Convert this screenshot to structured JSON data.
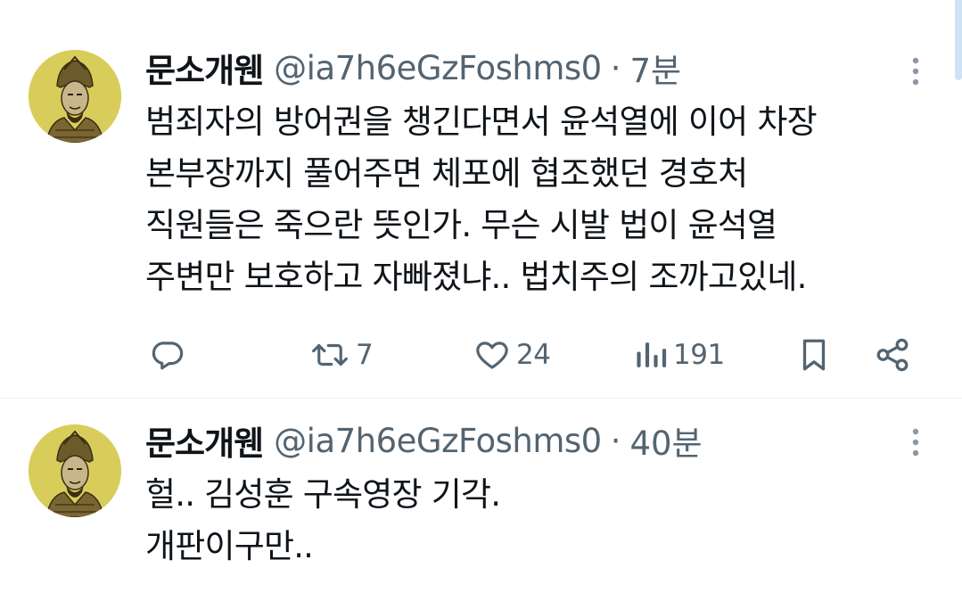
{
  "colors": {
    "text_primary": "#0f1419",
    "text_secondary": "#536471",
    "avatar_bg": "#d8cd5a",
    "divider": "#eff3f4",
    "scrollbar": "#cfe3f7"
  },
  "tweets": [
    {
      "author_name": "문소개웬",
      "handle": "@ia7h6eGzFoshms0",
      "separator": "·",
      "time": "7분",
      "avatar_icon": "warrior-portrait-avatar",
      "more_icon": "more-vertical-icon",
      "lines": [
        "범죄자의 방어권을 챙긴다면서 윤석열에 이어 차장",
        "본부장까지 풀어주면 체포에 협조했던 경호처",
        "직원들은 죽으란 뜻인가. 무슨 시발 법이 윤석열",
        "주변만 보호하고 자빠졌냐.. 법치주의 조까고있네."
      ],
      "actions": {
        "reply_icon": "reply-icon",
        "retweet_icon": "retweet-icon",
        "retweet_count": "7",
        "like_icon": "heart-icon",
        "like_count": "24",
        "views_icon": "views-icon",
        "views_count": "191",
        "bookmark_icon": "bookmark-icon",
        "share_icon": "share-icon"
      }
    },
    {
      "author_name": "문소개웬",
      "handle": "@ia7h6eGzFoshms0",
      "separator": "·",
      "time": "40분",
      "avatar_icon": "warrior-portrait-avatar",
      "more_icon": "more-vertical-icon",
      "lines": [
        "헐.. 김성훈 구속영장 기각.",
        "개판이구만.."
      ]
    }
  ]
}
